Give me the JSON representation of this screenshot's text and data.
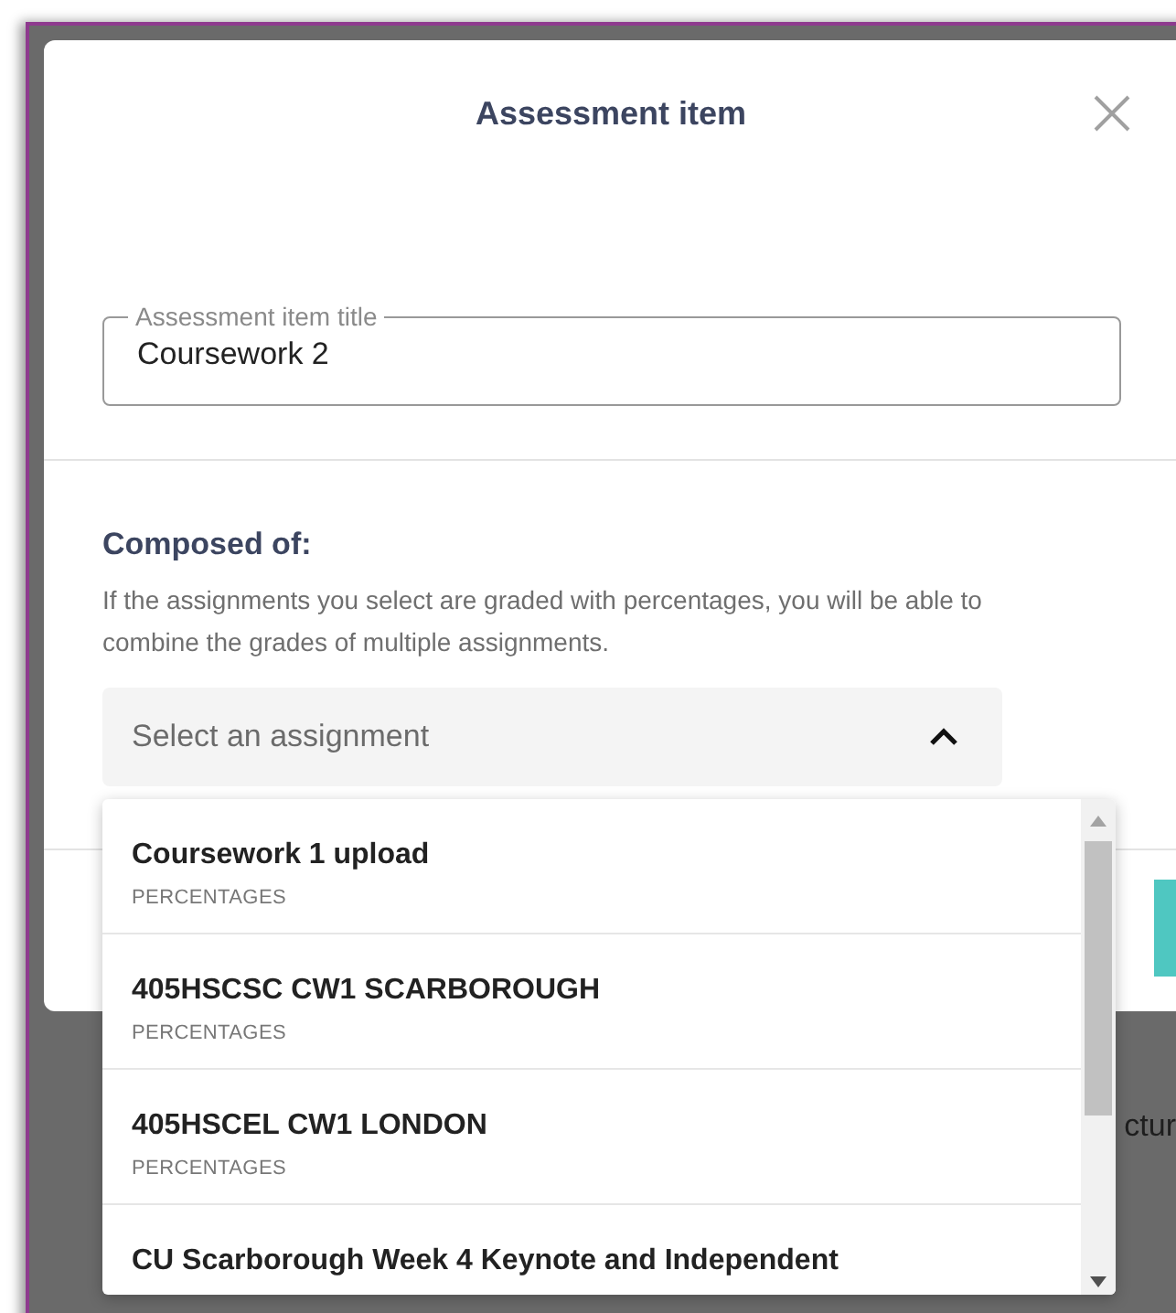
{
  "dialog": {
    "title": "Assessment item"
  },
  "title_field": {
    "label": "Assessment item title",
    "value": "Coursework 2"
  },
  "composed_of": {
    "heading": "Composed of:",
    "description": "If the assignments you select are graded with percentages, you will be able to combine the grades of multiple assignments."
  },
  "assignment_select": {
    "placeholder": "Select an assignment",
    "expanded": true
  },
  "options": [
    {
      "title": "Coursework 1 upload",
      "grading": "PERCENTAGES"
    },
    {
      "title": "405HSCSC CW1 SCARBOROUGH",
      "grading": "PERCENTAGES"
    },
    {
      "title": "405HSCEL CW1 LONDON",
      "grading": "PERCENTAGES"
    },
    {
      "title": "CU Scarborough Week 4 Keynote and Independent"
    }
  ],
  "background_text": "ctur"
}
